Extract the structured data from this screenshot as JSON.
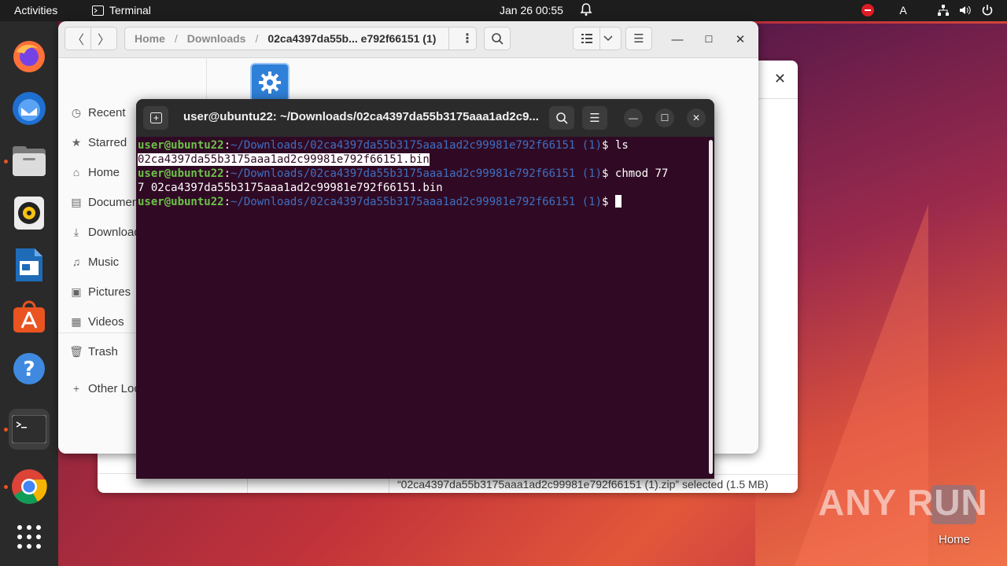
{
  "topbar": {
    "activities": "Activities",
    "app_name": "Terminal",
    "clock": "Jan 26  00:55",
    "tray_letter": "A"
  },
  "dock": {
    "items": [
      "firefox-icon",
      "thunderbird-icon",
      "files-icon",
      "rhythmbox-icon",
      "writer-icon",
      "software-icon",
      "help-icon",
      "terminal-icon",
      "chrome-icon",
      "app-grid-icon"
    ]
  },
  "files": {
    "path": {
      "home": "Home",
      "downloads": "Downloads",
      "current": "02ca4397da55b... e792f66151 (1)"
    },
    "sidebar": [
      {
        "label": "Recent",
        "icon": "clock-icon"
      },
      {
        "label": "Starred",
        "icon": "star-icon"
      },
      {
        "label": "Home",
        "icon": "home-icon"
      },
      {
        "label": "Documents",
        "icon": "document-icon"
      },
      {
        "label": "Downloads",
        "icon": "download-icon"
      },
      {
        "label": "Music",
        "icon": "music-icon"
      },
      {
        "label": "Pictures",
        "icon": "picture-icon"
      },
      {
        "label": "Videos",
        "icon": "video-icon"
      },
      {
        "label": "Trash",
        "icon": "trash-icon"
      },
      {
        "label": "Other Locations",
        "icon": "plus-icon"
      }
    ],
    "status": "“02ca4397da55b3175aaa1ad2c99981e792f66151 (1).zip” selected  (1.5 MB)"
  },
  "terminal": {
    "title": "user@ubuntu22: ~/Downloads/02ca4397da55b3175aaa1ad2c9...",
    "lines": [
      {
        "user": "user@ubuntu22",
        "path": "~/Downloads/02ca4397da55b3175aaa1ad2c99981e792f66151 (1)",
        "cmd": "ls"
      },
      {
        "output": "02ca4397da55b3175aaa1ad2c99981e792f66151.bin"
      },
      {
        "user": "user@ubuntu22",
        "path": "~/Downloads/02ca4397da55b3175aaa1ad2c99981e792f66151 (1)",
        "cmd": "chmod 77"
      },
      {
        "output": "7 02ca4397da55b3175aaa1ad2c99981e792f66151.bin"
      },
      {
        "user": "user@ubuntu22",
        "path": "~/Downloads/02ca4397da55b3175aaa1ad2c99981e792f66151 (1)",
        "cmd": ""
      }
    ]
  },
  "desktop": {
    "home_label": "Home",
    "watermark": "ANY RUN"
  }
}
